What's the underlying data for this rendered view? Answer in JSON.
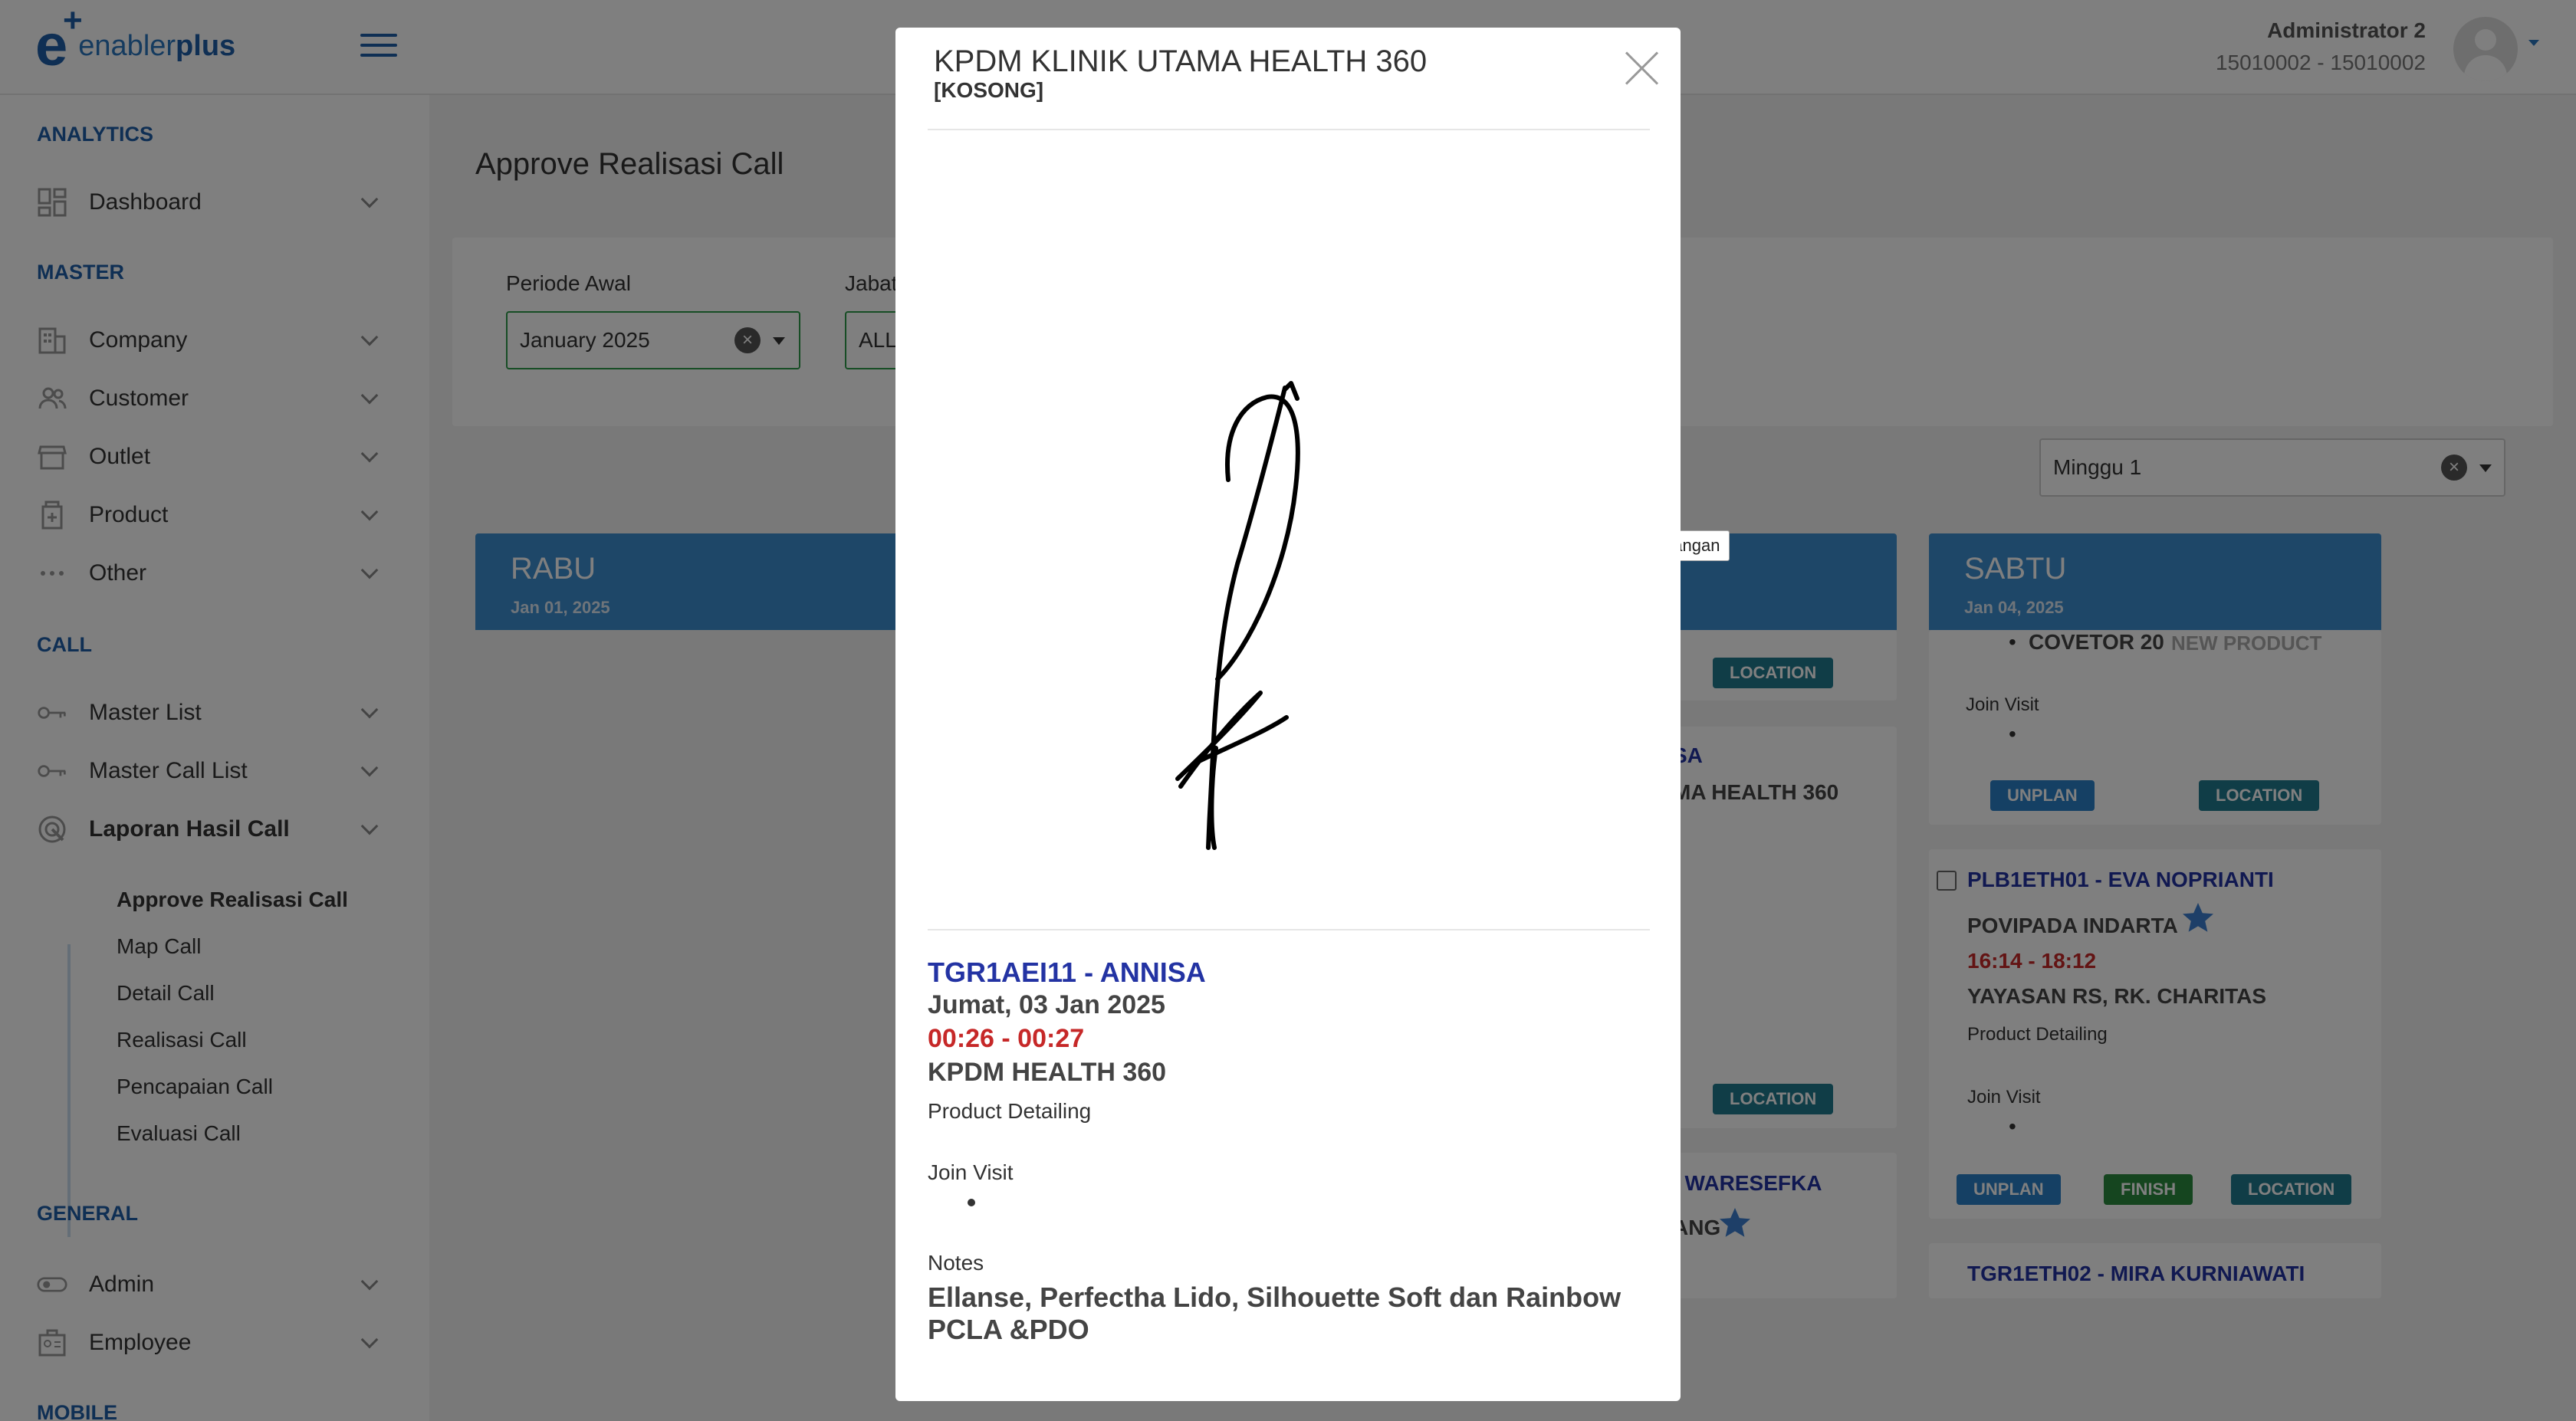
{
  "header": {
    "logo_mark": "e",
    "logo_text_light": "enabler",
    "logo_text_bold": "plus",
    "user_name": "Administrator 2",
    "user_id": "15010002 - 15010002"
  },
  "sidebar": {
    "sections": [
      "ANALYTICS",
      "MASTER",
      "CALL",
      "GENERAL",
      "MOBILE"
    ],
    "analytics": [
      {
        "label": "Dashboard",
        "icon": "dashboard-icon"
      }
    ],
    "master": [
      {
        "label": "Company",
        "icon": "building-icon"
      },
      {
        "label": "Customer",
        "icon": "users-icon"
      },
      {
        "label": "Outlet",
        "icon": "store-icon"
      },
      {
        "label": "Product",
        "icon": "product-icon"
      },
      {
        "label": "Other",
        "icon": "more-icon"
      }
    ],
    "call": [
      {
        "label": "Master List",
        "icon": "key-icon"
      },
      {
        "label": "Master Call List",
        "icon": "key-icon"
      },
      {
        "label": "Laporan Hasil Call",
        "icon": "report-icon"
      }
    ],
    "call_sub": [
      "Approve Realisasi Call",
      "Map Call",
      "Detail Call",
      "Realisasi Call",
      "Pencapaian Call",
      "Evaluasi Call"
    ],
    "general": [
      {
        "label": "Admin",
        "icon": "toggle-icon"
      },
      {
        "label": "Employee",
        "icon": "employee-icon"
      }
    ]
  },
  "main": {
    "title": "Approve Realisasi Call",
    "filters": {
      "periode_label": "Periode Awal",
      "periode_value": "January 2025",
      "jabatan_label": "Jabat",
      "jabatan_value": "ALL"
    },
    "week_value": "Minggu 1",
    "days": [
      {
        "name": "RABU",
        "date": "Jan 01, 2025"
      },
      {
        "name": "SABTU",
        "date": "Jan 04, 2025"
      }
    ],
    "middle_cards": {
      "card1_location": "LOCATION",
      "card2_line1": "SA",
      "card2_line2": "MA HEALTH 360",
      "card2_location": "LOCATION",
      "card3_line1": "I WARESEFKA",
      "card3_line2": "ANG"
    },
    "sabtu_cards": {
      "card1": {
        "product": "COVETOR 20",
        "product_tag": "NEW PRODUCT",
        "join_visit": "Join Visit",
        "badges": [
          "UNPLAN",
          "LOCATION"
        ]
      },
      "card2": {
        "code": "PLB1ETH01 - EVA NOPRIANTI",
        "name": "POVIPADA INDARTA",
        "time": "16:14 - 18:12",
        "place": "YAYASAN RS, RK. CHARITAS",
        "activity": "Product Detailing",
        "join_visit": "Join Visit",
        "badges": [
          "UNPLAN",
          "FINISH",
          "LOCATION"
        ]
      },
      "card3": {
        "code": "TGR1ETH02 - MIRA KURNIAWATI"
      }
    }
  },
  "tooltip": "Bukti Tanda Tangan",
  "modal": {
    "title": "KPDM KLINIK UTAMA HEALTH 360",
    "subtitle": "[KOSONG]",
    "code": "TGR1AEI11 - ANNISA",
    "date": "Jumat, 03 Jan 2025",
    "time": "00:26 - 00:27",
    "place": "KPDM HEALTH 360",
    "activity": "Product Detailing",
    "join_visit_label": "Join Visit",
    "notes_label": "Notes",
    "notes": "Ellanse, Perfectha Lido, Silhouette Soft dan Rainbow PCLA &PDO"
  },
  "colors": {
    "brand": "#1f5fa8",
    "day_header": "#3d8fd1",
    "time_red": "#c62828",
    "code_blue": "#2333a3"
  }
}
